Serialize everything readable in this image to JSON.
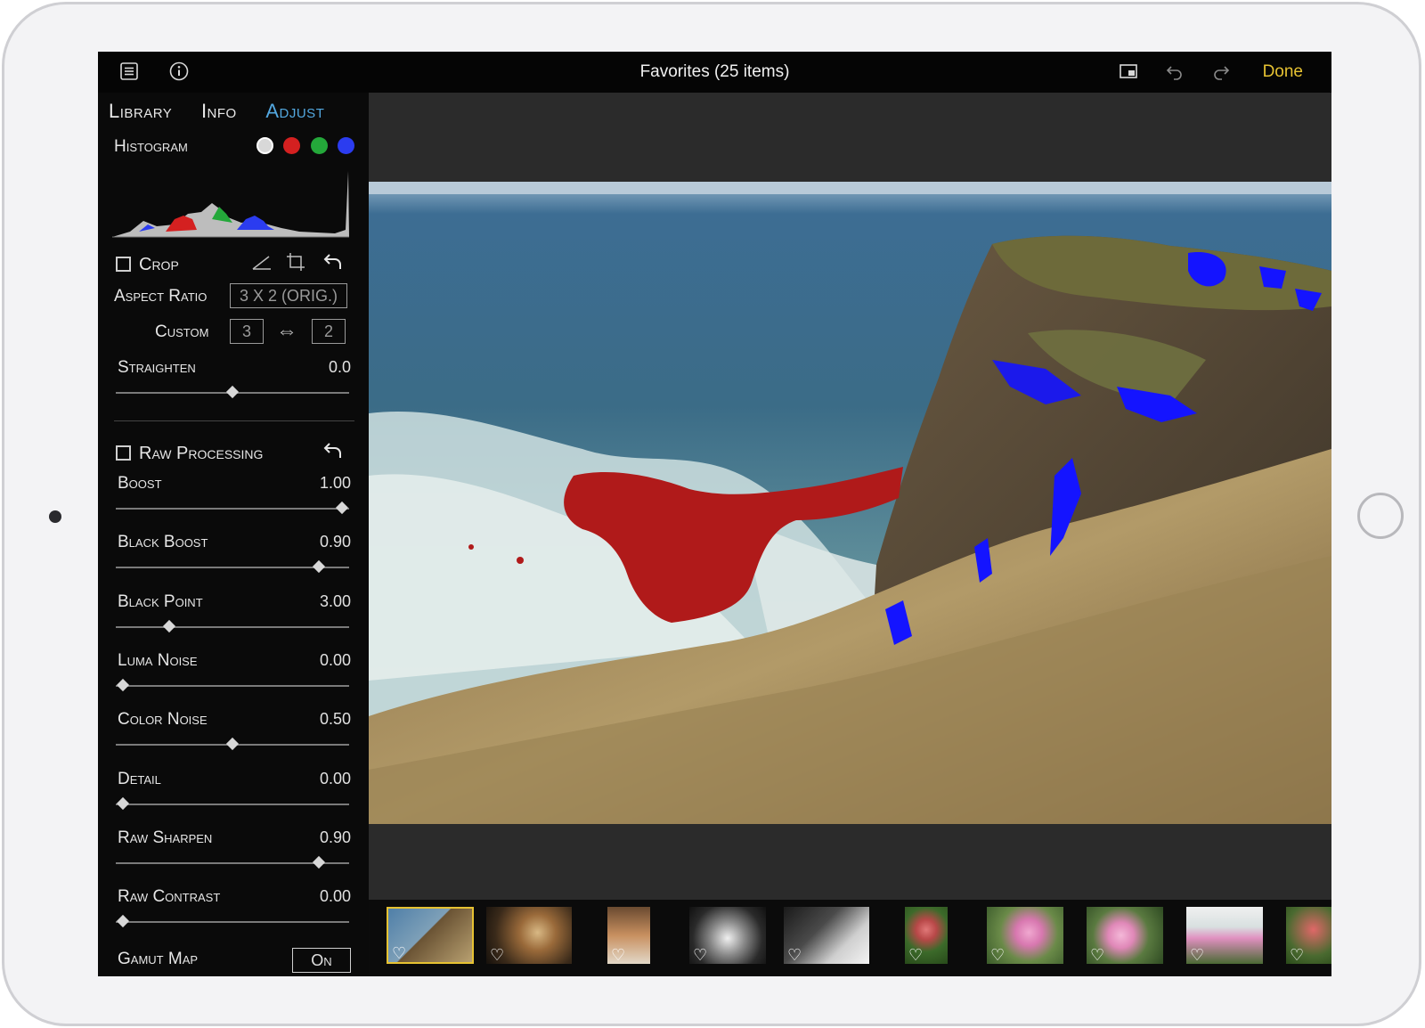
{
  "window": {
    "title": "Favorites (25 items)",
    "done_label": "Done"
  },
  "toolbar": {
    "left_icons": [
      "list-icon",
      "info-icon"
    ],
    "right_icons": [
      "compare-view-icon",
      "undo-icon",
      "redo-icon"
    ]
  },
  "tabs": [
    {
      "label": "Library",
      "active": false
    },
    {
      "label": "Info",
      "active": false
    },
    {
      "label": "Adjust",
      "active": true
    }
  ],
  "histogram": {
    "label": "Histogram",
    "channel_colors": [
      "#d8d8d8",
      "#d42020",
      "#24a83a",
      "#2b3cf0"
    ]
  },
  "crop": {
    "label": "Crop",
    "checked": false,
    "aspect_ratio_label": "Aspect Ratio",
    "aspect_ratio_value": "3 X 2 (ORIG.)",
    "custom_label": "Custom",
    "custom_w": "3",
    "custom_h": "2",
    "straighten_label": "Straighten",
    "straighten_value": "0.0",
    "straighten_level": 0.5
  },
  "raw": {
    "label": "Raw Processing",
    "checked": false,
    "sliders": [
      {
        "label": "Boost",
        "value": "1.00",
        "level": 0.97
      },
      {
        "label": "Black Boost",
        "value": "0.90",
        "level": 0.87
      },
      {
        "label": "Black Point",
        "value": "3.00",
        "level": 0.23
      },
      {
        "label": "Luma Noise",
        "value": "0.00",
        "level": 0.03
      },
      {
        "label": "Color Noise",
        "value": "0.50",
        "level": 0.5
      },
      {
        "label": "Detail",
        "value": "0.00",
        "level": 0.03
      },
      {
        "label": "Raw Sharpen",
        "value": "0.90",
        "level": 0.87
      },
      {
        "label": "Raw Contrast",
        "value": "0.00",
        "level": 0.03
      }
    ],
    "gamut_label": "Gamut Map",
    "gamut_value": "On"
  },
  "filmstrip": {
    "thumbnails": [
      {
        "subject": "cliff-ocean",
        "selected": true
      },
      {
        "subject": "nautilus-shell",
        "selected": false
      },
      {
        "subject": "kitchen",
        "selected": false
      },
      {
        "subject": "dog-bw",
        "selected": false
      },
      {
        "subject": "dog-bw-2",
        "selected": false
      },
      {
        "subject": "roses",
        "selected": false
      },
      {
        "subject": "pink-flowers",
        "selected": false
      },
      {
        "subject": "pink-flowers-2",
        "selected": false
      },
      {
        "subject": "pink-flower-house",
        "selected": false
      },
      {
        "subject": "rose-partial",
        "selected": false
      }
    ]
  }
}
